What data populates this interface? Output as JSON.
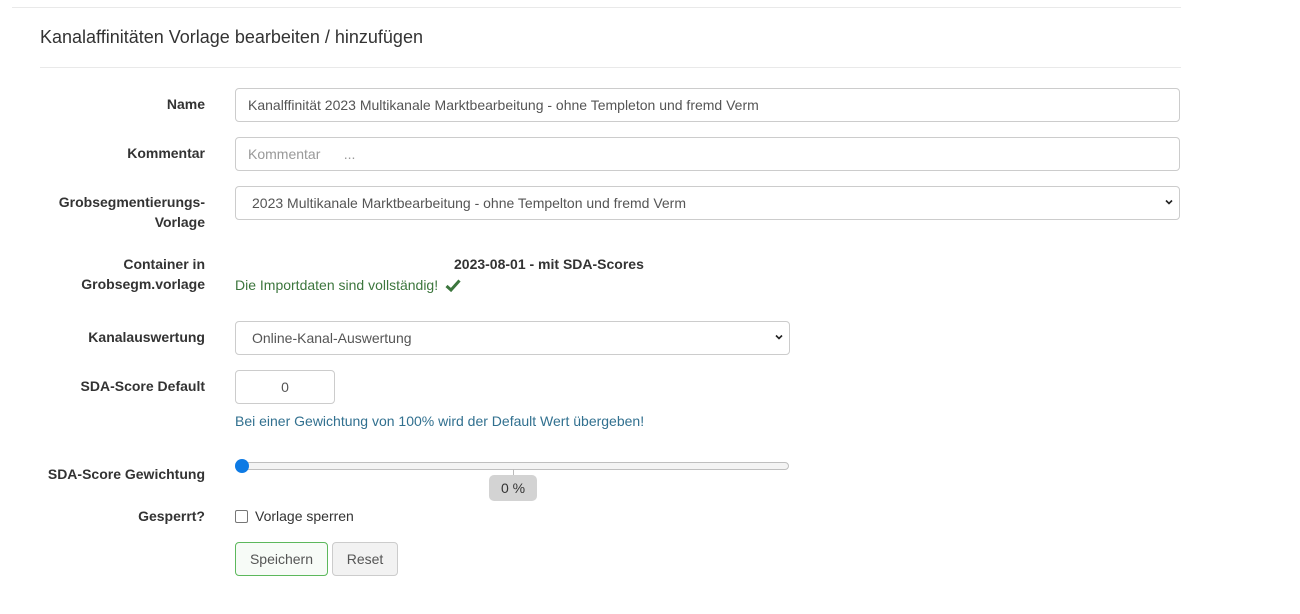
{
  "panel": {
    "title": "Kanalaffinitäten Vorlage bearbeiten / hinzufügen"
  },
  "form": {
    "name": {
      "label": "Name",
      "value": "Kanalffinität 2023 Multikanale Marktbearbeitung - ohne Templeton und fremd Verm"
    },
    "kommentar": {
      "label": "Kommentar",
      "placeholder": "Kommentar      ..."
    },
    "grobsegmentierung": {
      "label_line1": "Grobsegmentierungs-",
      "label_line2": "Vorlage",
      "selected": "2023 Multikanale Marktbearbeitung - ohne Tempelton und fremd Verm"
    },
    "container": {
      "label_line1": "Container in",
      "label_line2": "Grobsegm.vorlage",
      "name": "2023-08-01 - mit SDA-Scores",
      "status_text": "Die Importdaten sind vollständig!",
      "status_icon": "check-icon",
      "status_color": "#3c763d"
    },
    "kanalauswertung": {
      "label": "Kanalauswertung",
      "selected": "Online-Kanal-Auswertung"
    },
    "sda_default": {
      "label": "SDA-Score Default",
      "value": "0",
      "info": "Bei einer Gewichtung von 100% wird der Default Wert übergeben!",
      "info_color": "#31708f"
    },
    "sda_gewichtung": {
      "label": "SDA-Score Gewichtung",
      "value_percent": 0,
      "display": "0 %"
    },
    "gesperrt": {
      "label": "Gesperrt?",
      "checkbox_label": "Vorlage sperren",
      "checked": false
    },
    "buttons": {
      "save": "Speichern",
      "reset": "Reset"
    }
  },
  "colors": {
    "accent": "#0d7ae4",
    "save_border": "#5cb85c"
  }
}
